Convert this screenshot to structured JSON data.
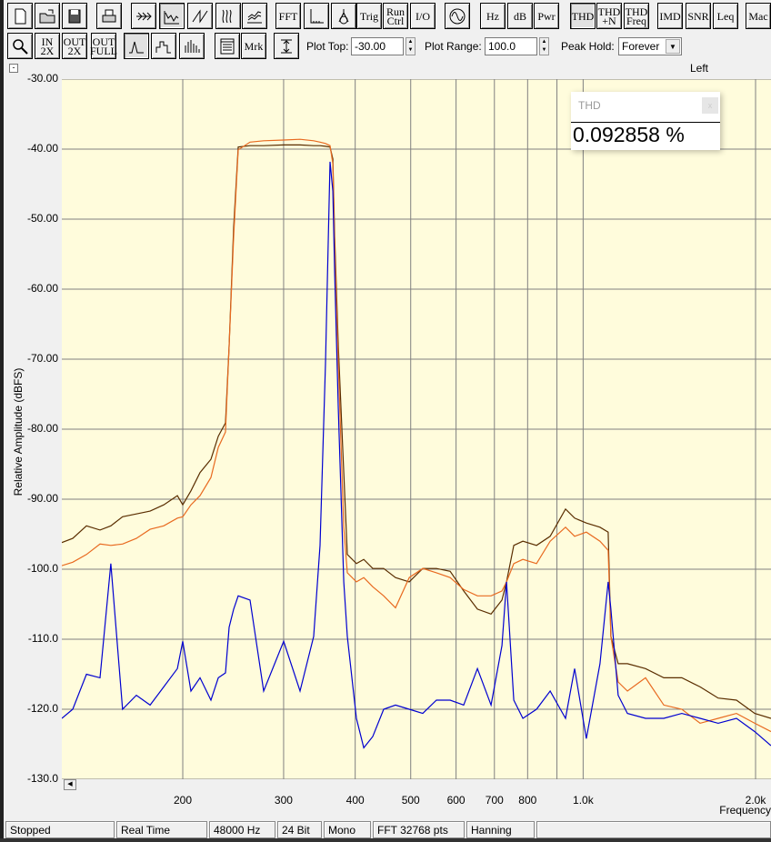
{
  "toolbar1": [
    {
      "name": "new-document-button",
      "icon": "new-document-icon",
      "label": ""
    },
    {
      "name": "open-button",
      "icon": "open-folder-icon",
      "label": ""
    },
    {
      "name": "save-button",
      "icon": "save-icon",
      "label": ""
    },
    {
      "name": "print-button",
      "icon": "print-icon",
      "label": ""
    },
    {
      "name": "time-series-button",
      "icon": "signal-arrows-icon",
      "label": ""
    },
    {
      "name": "spectrum-button",
      "icon": "spectrum-icon",
      "label": "",
      "active": true
    },
    {
      "name": "sawtooth-button",
      "icon": "sawtooth-icon",
      "label": ""
    },
    {
      "name": "spectrogram-button",
      "icon": "spectrogram-icon",
      "label": ""
    },
    {
      "name": "3d-surface-button",
      "icon": "3d-surface-icon",
      "label": ""
    },
    {
      "name": "fft-button",
      "label": "FFT"
    },
    {
      "name": "axis-button",
      "icon": "axis-icon",
      "label": ""
    },
    {
      "name": "compass-button",
      "icon": "compass-icon",
      "label": ""
    },
    {
      "name": "trig-button",
      "label": "Trig"
    },
    {
      "name": "run-ctrl-button",
      "label": "Run Ctrl"
    },
    {
      "name": "io-button",
      "label": "I/O"
    },
    {
      "name": "generator-button",
      "icon": "sine-wave-icon",
      "label": ""
    },
    {
      "name": "hz-button",
      "label": "Hz"
    },
    {
      "name": "db-button",
      "label": "dB"
    },
    {
      "name": "pwr-button",
      "label": "Pwr"
    },
    {
      "name": "thd-button",
      "label": "THD",
      "active": true
    },
    {
      "name": "thd-n-button",
      "label": "THD +N"
    },
    {
      "name": "thd-freq-button",
      "label": "THD Freq"
    },
    {
      "name": "imd-button",
      "label": "IMD"
    },
    {
      "name": "snr-button",
      "label": "SNR"
    },
    {
      "name": "leq-button",
      "label": "Leq"
    },
    {
      "name": "macro-button",
      "label": "Mac"
    }
  ],
  "toolbar2": [
    {
      "name": "zoom-button",
      "icon": "magnifier-icon",
      "label": ""
    },
    {
      "name": "zoom-in-2x-button",
      "label": "IN 2X"
    },
    {
      "name": "zoom-out-2x-button",
      "label": "OUT 2X"
    },
    {
      "name": "zoom-out-full-button",
      "label": "OUT FULL"
    },
    {
      "name": "line-mode-button",
      "icon": "peak-line-icon",
      "label": "",
      "active": true
    },
    {
      "name": "step-mode-button",
      "icon": "step-icon",
      "label": ""
    },
    {
      "name": "bar-mode-button",
      "icon": "bars-icon",
      "label": ""
    },
    {
      "name": "panel-button",
      "icon": "panel-icon",
      "label": ""
    },
    {
      "name": "marker-button",
      "label": "Mrk"
    },
    {
      "name": "range-button",
      "icon": "range-height-icon",
      "label": ""
    }
  ],
  "controls": {
    "plot_top_label": "Plot Top:",
    "plot_top": "-30.00",
    "plot_range_label": "Plot Range:",
    "plot_range": "100.0",
    "peak_hold_label": "Peak Hold:",
    "peak_hold": "Forever"
  },
  "channel": "Left",
  "thd_box": {
    "title": "THD",
    "value": "0.092858 %",
    "close": "x"
  },
  "status": [
    "Stopped",
    "Real Time",
    "48000 Hz",
    "24 Bit",
    "Mono",
    "FFT 32768 pts",
    "Hanning"
  ],
  "colors": {
    "plot_bg": "#fffcdc",
    "grid": "#808080",
    "blue": "#0000d0",
    "dark": "#5a2d00",
    "orange": "#e86a20"
  },
  "chart_data": {
    "type": "line",
    "xlabel": "Frequency",
    "ylabel": "Relative Amplitude (dBFS)",
    "xscale": "log",
    "xlim": [
      123,
      2128
    ],
    "ylim": [
      -130,
      -30
    ],
    "yticks": [
      "-30.00",
      "-40.00",
      "-50.00",
      "-60.00",
      "-70.00",
      "-80.00",
      "-90.00",
      "-100.0",
      "-110.0",
      "-120.0",
      "-130.0"
    ],
    "ytick_values": [
      -30,
      -40,
      -50,
      -60,
      -70,
      -80,
      -90,
      -100,
      -110,
      -120,
      -130
    ],
    "xgrid": [
      200,
      300,
      400,
      500,
      600,
      700,
      800,
      900,
      1000,
      2000
    ],
    "xticks": [
      {
        "v": 200,
        "t": "200"
      },
      {
        "v": 300,
        "t": "300"
      },
      {
        "v": 400,
        "t": "400"
      },
      {
        "v": 500,
        "t": "500"
      },
      {
        "v": 600,
        "t": "600"
      },
      {
        "v": 700,
        "t": "700"
      },
      {
        "v": 800,
        "t": "800"
      },
      {
        "v": 1000,
        "t": "1.0k"
      },
      {
        "v": 2000,
        "t": "2.0k"
      }
    ],
    "x": [
      123,
      128.5,
      135.8,
      143.4,
      149.8,
      157,
      166,
      175.4,
      185.3,
      195.7,
      200,
      206.7,
      214.4,
      224,
      230.7,
      237.5,
      241,
      245.4,
      249.9,
      262.1,
      276.9,
      300,
      320.4,
      338.5,
      347.3,
      355,
      361.5,
      365.6,
      368.3,
      373.7,
      382,
      387.6,
      402,
      414,
      429.3,
      448.5,
      470.4,
      497,
      524.8,
      554.5,
      585.8,
      618.8,
      653.8,
      690.7,
      721.6,
      735,
      756.7,
      784.9,
      829,
      875.7,
      931.7,
      966.3,
      1013,
      1070,
      1106,
      1118,
      1151,
      1195,
      1285,
      1383,
      1487,
      1600,
      1721,
      1852,
      1993,
      2128
    ],
    "series": [
      {
        "name": "peak-hold-dark",
        "color": "#5a2d00",
        "values": [
          -96.2,
          -95.6,
          -93.8,
          -94.4,
          -93.8,
          -92.5,
          -92.1,
          -91.7,
          -90.8,
          -89.5,
          -90.8,
          -88.8,
          -86.2,
          -84.3,
          -81,
          -79.1,
          -68.1,
          -51.2,
          -39.7,
          -39.5,
          -39.5,
          -39.4,
          -39.4,
          -39.5,
          -39.5,
          -39.6,
          -39.7,
          -41.4,
          -52.5,
          -68.1,
          -86.2,
          -97.9,
          -99.2,
          -98.6,
          -99.9,
          -99.9,
          -101.2,
          -101.8,
          -99.9,
          -99.9,
          -100.3,
          -103.1,
          -105.7,
          -106.4,
          -104.4,
          -101.8,
          -96.6,
          -96,
          -96.6,
          -95.3,
          -91.4,
          -92.7,
          -93.4,
          -94,
          -94.7,
          -109.6,
          -113.5,
          -113.5,
          -114.2,
          -115.5,
          -115.5,
          -116.8,
          -118.4,
          -118.7,
          -120.6,
          -121.3
        ]
      },
      {
        "name": "peak-hold-orange",
        "color": "#e86a20",
        "values": [
          -99.5,
          -99,
          -97.9,
          -96.4,
          -96.6,
          -96.4,
          -95.6,
          -94.3,
          -93.8,
          -92.7,
          -92.5,
          -90.8,
          -89.5,
          -86.9,
          -82.6,
          -80.4,
          -68.1,
          -52.5,
          -40.1,
          -39,
          -38.8,
          -38.7,
          -38.6,
          -38.8,
          -39,
          -39.2,
          -39.5,
          -42.1,
          -53.8,
          -70.6,
          -94,
          -100.5,
          -101.8,
          -101.2,
          -102.5,
          -103.8,
          -105.5,
          -101.2,
          -99.9,
          -100.5,
          -101.2,
          -102.9,
          -103.8,
          -103.8,
          -103.1,
          -101.8,
          -99.2,
          -98.6,
          -99.2,
          -96,
          -94,
          -95.3,
          -94.7,
          -96,
          -97.3,
          -109.6,
          -116.1,
          -117.4,
          -115.5,
          -119.4,
          -120,
          -122,
          -121.3,
          -120.6,
          -122,
          -123.2
        ]
      },
      {
        "name": "current-blue",
        "color": "#0000d0",
        "values": [
          -121.3,
          -120,
          -115,
          -115.5,
          -99.2,
          -120,
          -118,
          -119.4,
          -116.8,
          -114.2,
          -110.3,
          -117.4,
          -115.5,
          -118.7,
          -115.5,
          -114.8,
          -108.3,
          -105.7,
          -103.8,
          -104.4,
          -117.4,
          -110.3,
          -117.4,
          -109.6,
          -96.6,
          -70.6,
          -41.8,
          -46,
          -57.7,
          -77.1,
          -101.8,
          -109.6,
          -121.3,
          -125.5,
          -123.9,
          -120,
          -119.4,
          -120,
          -120.6,
          -118.7,
          -118.7,
          -119.4,
          -114.2,
          -119.4,
          -110.9,
          -101.8,
          -118.7,
          -121.3,
          -120,
          -117.4,
          -121.3,
          -114.2,
          -124.2,
          -113.5,
          -101.8,
          -105.7,
          -118,
          -120.6,
          -121.3,
          -121.3,
          -120.6,
          -121.3,
          -122,
          -121.3,
          -123.2,
          -125.2
        ]
      }
    ]
  }
}
